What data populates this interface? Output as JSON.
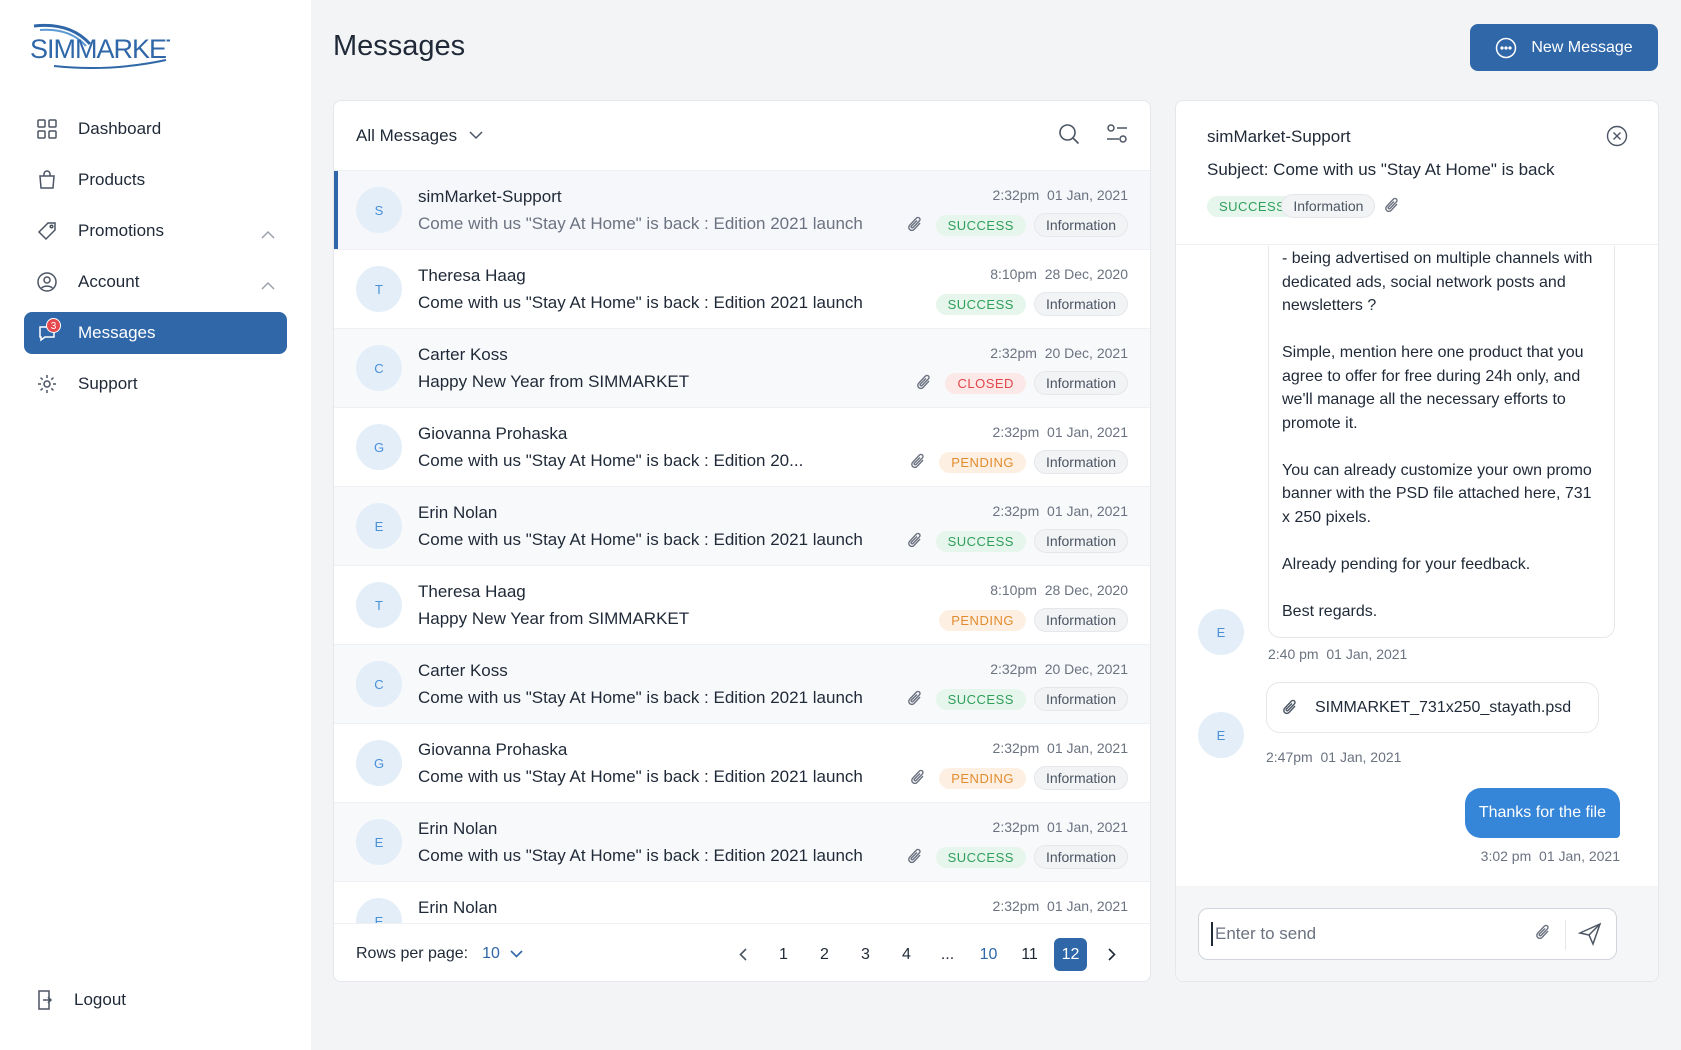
{
  "app": {
    "logo_text": "SIMMARKET",
    "page_title": "Messages",
    "new_message_label": "New Message",
    "colors": {
      "accent": "#2f67a8",
      "bubble_out": "#3585d8",
      "success": "#2f9e5b",
      "closed": "#e0464b",
      "pending": "#e28b2e"
    }
  },
  "sidebar": {
    "items": [
      {
        "label": "Dashboard",
        "icon": "grid-icon"
      },
      {
        "label": "Products",
        "icon": "bag-icon"
      },
      {
        "label": "Promotions",
        "icon": "tag-icon",
        "expandable": true
      },
      {
        "label": "Account",
        "icon": "user-circle-icon",
        "expandable": true
      },
      {
        "label": "Messages",
        "icon": "chat-icon",
        "active": true,
        "badge": "3"
      },
      {
        "label": "Support",
        "icon": "gear-icon"
      }
    ],
    "logout_label": "Logout"
  },
  "list": {
    "filter_label": "All Messages",
    "rows": [
      {
        "initial": "S",
        "name": "simMarket-Support",
        "subject": "Come with us \"Stay At Home\" is back : Edition 2021 launch",
        "time": "2:32pm",
        "date": "01 Jan, 2021",
        "attachment": true,
        "status": "SUCCESS",
        "category": "Information"
      },
      {
        "initial": "T",
        "name": "Theresa Haag",
        "subject": "Come with us \"Stay At Home\" is back : Edition 2021 launch",
        "time": "8:10pm",
        "date": "28 Dec, 2020",
        "attachment": false,
        "status": "SUCCESS",
        "category": "Information"
      },
      {
        "initial": "C",
        "name": "Carter Koss",
        "subject": "Happy New Year from SIMMARKET",
        "time": "2:32pm",
        "date": "20 Dec, 2021",
        "attachment": true,
        "status": "CLOSED",
        "category": "Information"
      },
      {
        "initial": "G",
        "name": "Giovanna Prohaska",
        "subject": "Come with us \"Stay At Home\" is back : Edition 20...",
        "time": "2:32pm",
        "date": "01 Jan, 2021",
        "attachment": true,
        "status": "PENDING",
        "category": "Information"
      },
      {
        "initial": "E",
        "name": "Erin Nolan",
        "subject": "Come with us \"Stay At Home\" is back : Edition 2021 launch",
        "time": "2:32pm",
        "date": "01 Jan, 2021",
        "attachment": true,
        "status": "SUCCESS",
        "category": "Information"
      },
      {
        "initial": "T",
        "name": "Theresa Haag",
        "subject": "Happy New Year from SIMMARKET",
        "time": "8:10pm",
        "date": "28 Dec, 2020",
        "attachment": false,
        "status": "PENDING",
        "category": "Information"
      },
      {
        "initial": "C",
        "name": "Carter Koss",
        "subject": "Come with us \"Stay At Home\" is back : Edition 2021 launch",
        "time": "2:32pm",
        "date": "20 Dec, 2021",
        "attachment": true,
        "status": "SUCCESS",
        "category": "Information"
      },
      {
        "initial": "G",
        "name": "Giovanna Prohaska",
        "subject": "Come with us \"Stay At Home\" is back : Edition 2021 launch",
        "time": "2:32pm",
        "date": "01 Jan, 2021",
        "attachment": true,
        "status": "PENDING",
        "category": "Information"
      },
      {
        "initial": "E",
        "name": "Erin Nolan",
        "subject": "Come with us \"Stay At Home\" is back : Edition 2021 launch",
        "time": "2:32pm",
        "date": "01 Jan, 2021",
        "attachment": true,
        "status": "SUCCESS",
        "category": "Information"
      },
      {
        "initial": "E",
        "name": "Erin Nolan",
        "subject": "",
        "time": "2:32pm",
        "date": "01 Jan, 2021",
        "attachment": false,
        "status": "",
        "category": ""
      }
    ],
    "footer": {
      "rows_per_page_label": "Rows per page:",
      "rows_per_page_value": "10",
      "pages": [
        "1",
        "2",
        "3",
        "4",
        "...",
        "10",
        "11",
        "12"
      ],
      "current_page": "12"
    }
  },
  "detail": {
    "sender": "simMarket-Support",
    "subject_label": "Subject:",
    "subject": "Come with us \"Stay At Home\" is back",
    "status": "SUCCESS",
    "category": "Information",
    "messages": {
      "incoming_paragraphs": [
        "- being advertised on multiple channels with dedicated ads, social network posts and newsletters ?",
        "Simple, mention here one product that you agree to offer for free during 24h only, and we'll manage all the necessary efforts to promote it.",
        "You can already customize your own promo banner with the PSD file attached here, 731 x 250 pixels.",
        "Already pending for your feedback.",
        "Best regards."
      ],
      "incoming_initial": "E",
      "incoming_time": "2:40 pm",
      "incoming_date": "01 Jan, 2021",
      "file_name": "SIMMARKET_731x250_stayath.psd",
      "file_initial": "E",
      "file_time": "2:47pm",
      "file_date": "01 Jan, 2021",
      "outgoing_text": "Thanks for the file",
      "outgoing_time": "3:02 pm",
      "outgoing_date": "01 Jan, 2021"
    },
    "composer_placeholder": "Enter to send"
  }
}
